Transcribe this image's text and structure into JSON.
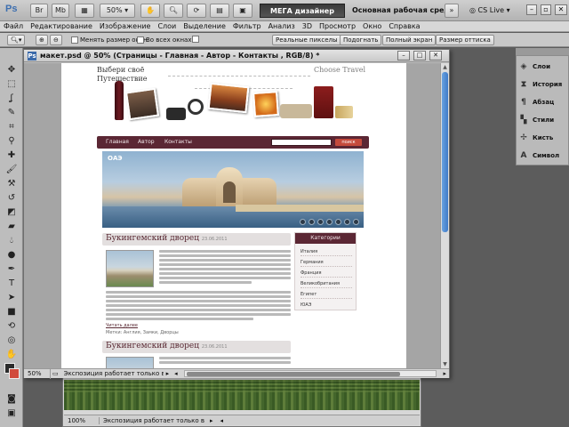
{
  "app": {
    "logo": "Ps",
    "br_label": "Br",
    "mb_label": "Mb",
    "zoom": "50%",
    "workspace_button": "МЕГА дизайнер Лёха=)",
    "workspace_label": "Основная рабочая среда",
    "cs_live": "CS Live",
    "menu": [
      "Файл",
      "Редактирование",
      "Изображение",
      "Слои",
      "Выделение",
      "Фильтр",
      "Анализ",
      "3D",
      "Просмотр",
      "Окно",
      "Справка"
    ]
  },
  "options": {
    "resize_windows": "Менять размер окон",
    "all_windows": "Во всех окнах",
    "buttons": [
      "Реальные пикселы",
      "Подогнать",
      "Полный экран",
      "Размер оттиска"
    ]
  },
  "panels": [
    {
      "label": "Слои",
      "icon": "layers-icon"
    },
    {
      "label": "История",
      "icon": "history-icon"
    },
    {
      "label": "Абзац",
      "icon": "paragraph-icon"
    },
    {
      "label": "Стили",
      "icon": "styles-icon"
    },
    {
      "label": "Кисть",
      "icon": "brush-icon"
    },
    {
      "label": "Символ",
      "icon": "character-icon"
    }
  ],
  "document": {
    "title": "макет.psd @ 50% (Страницы - Главная - Автор - Контакты , RGB/8) *",
    "zoom": "50%",
    "status": "Экспозиция работает только в ..."
  },
  "background_document": {
    "zoom": "100%",
    "status": "Экспозиция работает только в ..."
  },
  "webpage": {
    "slogan": "Выбери своё\nПутешествие",
    "brand": "Choose Travel",
    "nav": [
      "Главная",
      "Автор",
      "Контакты"
    ],
    "search_button": "поиск",
    "banner_label": "ОАЭ",
    "article1": {
      "title": "Букингемский дворец",
      "date": "23.06.2011",
      "read_more": "Читать далее",
      "tags": "Метки: Англия, Замки, Дворцы"
    },
    "article2": {
      "title": "Букингемский дворец",
      "date": "23.06.2011"
    },
    "sidebar": {
      "heading": "Категории",
      "items": [
        "Италия",
        "Германия",
        "Франция",
        "Великобритания",
        "Египет",
        "ЮАЭ"
      ]
    }
  }
}
